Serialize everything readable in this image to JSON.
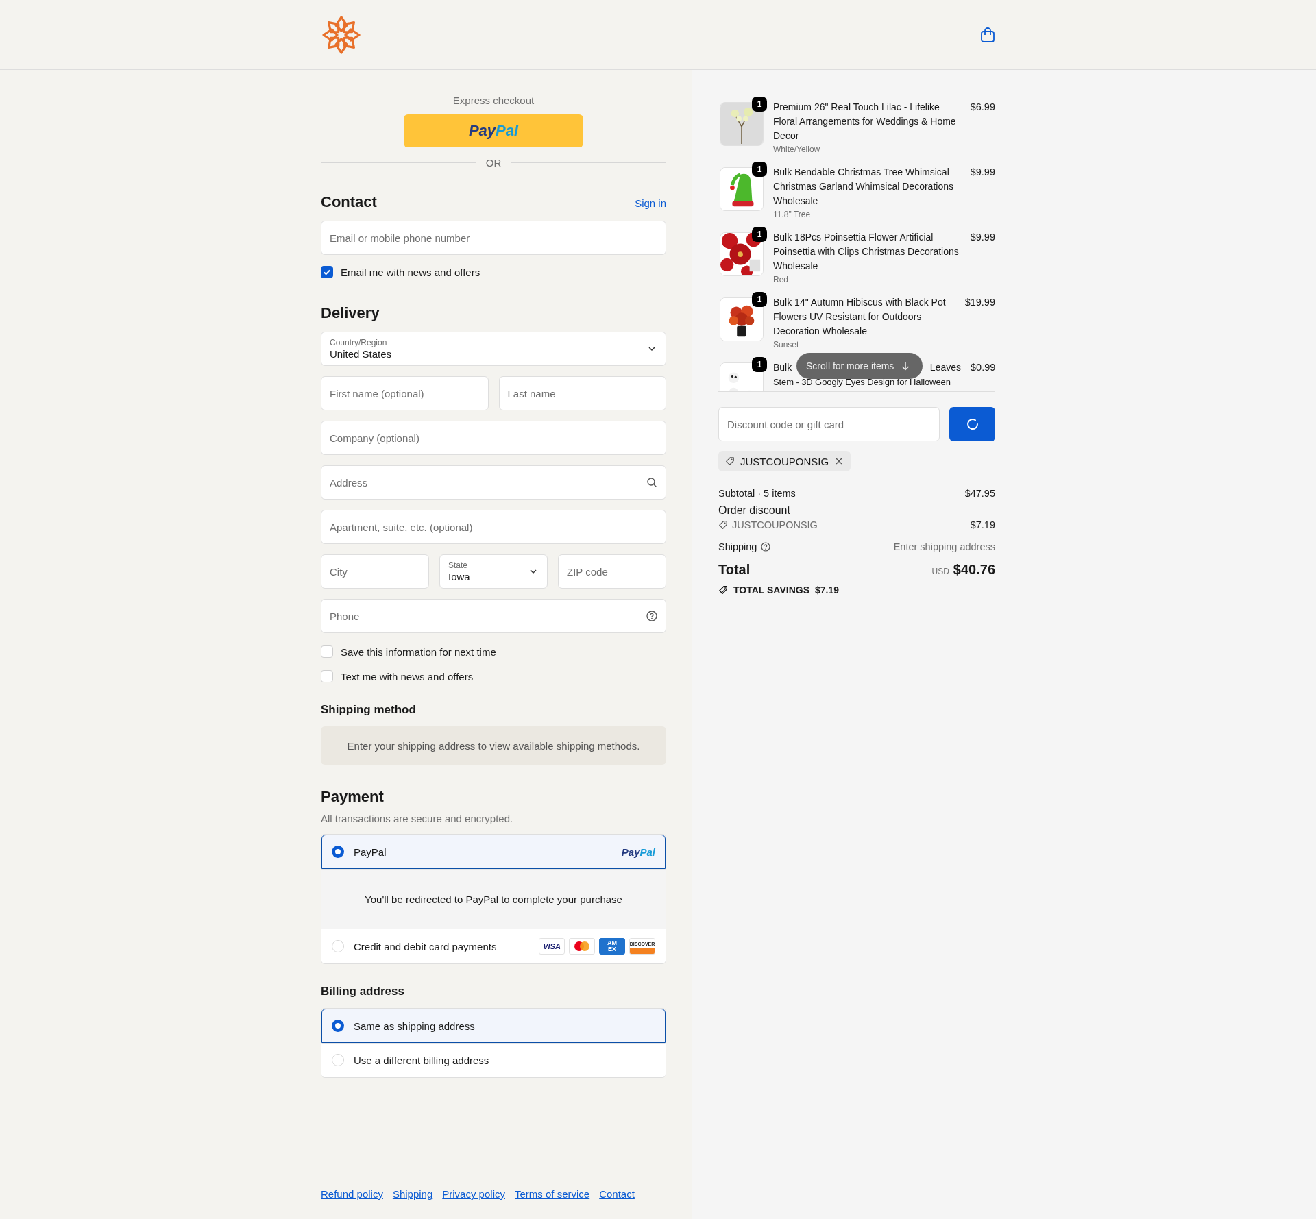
{
  "express": {
    "title": "Express checkout",
    "logo_parts": [
      "Pay",
      "Pal"
    ],
    "divider": "OR"
  },
  "contact": {
    "heading": "Contact",
    "sign_in": "Sign in",
    "email": {
      "placeholder": "Email or mobile phone number"
    },
    "news": {
      "label": "Email me with news and offers",
      "checked": true
    }
  },
  "delivery": {
    "heading": "Delivery",
    "rows": [
      [
        {
          "kind": "select",
          "label": "Country/Region",
          "value": "United States"
        }
      ],
      [
        {
          "kind": "text",
          "placeholder": "First name (optional)"
        },
        {
          "kind": "text",
          "placeholder": "Last name"
        }
      ],
      [
        {
          "kind": "text",
          "placeholder": "Company (optional)"
        }
      ],
      [
        {
          "kind": "search",
          "placeholder": "Address"
        }
      ],
      [
        {
          "kind": "text",
          "placeholder": "Apartment, suite, etc. (optional)"
        }
      ],
      [
        {
          "kind": "text",
          "placeholder": "City"
        },
        {
          "kind": "select",
          "label": "State",
          "value": "Iowa"
        },
        {
          "kind": "text",
          "placeholder": "ZIP code"
        }
      ],
      [
        {
          "kind": "help",
          "placeholder": "Phone"
        }
      ]
    ],
    "options": [
      {
        "label": "Save this information for next time",
        "checked": false
      },
      {
        "label": "Text me with news and offers",
        "checked": false
      }
    ]
  },
  "shipping_method": {
    "heading": "Shipping method",
    "notice": "Enter your shipping address to view available shipping methods."
  },
  "payment": {
    "heading": "Payment",
    "subtitle": "All transactions are secure and encrypted.",
    "methods": [
      {
        "kind": "paypal",
        "label": "PayPal",
        "selected": true,
        "logo_parts": [
          "Pay",
          "Pal"
        ],
        "detail": "You'll be redirected to PayPal to complete your purchase"
      },
      {
        "kind": "cards",
        "label": "Credit and debit card payments",
        "selected": false,
        "brands": [
          {
            "kind": "visa",
            "label": "VISA"
          },
          {
            "kind": "mastercard"
          },
          {
            "kind": "amex",
            "label": "AMEX"
          },
          {
            "kind": "discover",
            "label": "DISCOVER"
          }
        ]
      }
    ]
  },
  "billing": {
    "heading": "Billing address",
    "options": [
      {
        "label": "Same as shipping address",
        "selected": true
      },
      {
        "label": "Use a different billing address",
        "selected": false
      }
    ]
  },
  "footer_links": [
    "Refund policy",
    "Shipping",
    "Privacy policy",
    "Terms of service",
    "Contact"
  ],
  "summary": {
    "items": [
      {
        "kind": "full",
        "quantity": "1",
        "title": "Premium 26\" Real Touch Lilac - Lifelike Floral Arrangements for Weddings & Home Decor",
        "variant": "White/Yellow",
        "price": "$6.99"
      },
      {
        "kind": "full",
        "quantity": "1",
        "title": "Bulk Bendable Christmas Tree Whimsical Christmas Garland Whimsical Decorations Wholesale",
        "variant": "11.8\" Tree",
        "price": "$9.99"
      },
      {
        "kind": "full",
        "quantity": "1",
        "title": "Bulk 18Pcs Poinsettia Flower Artificial Poinsettia with Clips Christmas Decorations Wholesale",
        "variant": "Red",
        "price": "$9.99"
      },
      {
        "kind": "full",
        "quantity": "1",
        "title": "Bulk 14\" Autumn Hibiscus with Black Pot Flowers UV Resistant for Outdoors Decoration Wholesale",
        "variant": "Sunset",
        "price": "$19.99"
      },
      {
        "kind": "partial",
        "quantity": "1",
        "title_parts": [
          "Bulk",
          "Leaves"
        ],
        "title_line_2": "Stem - 3D Googly Eyes Design for Halloween",
        "price": "$0.99"
      }
    ],
    "scroll_hint": "Scroll for more items",
    "discount": {
      "placeholder": "Discount code or gift card"
    },
    "applied_code": "JUSTCOUPONSIG",
    "totals": {
      "subtotal": {
        "label": "Subtotal · 5 items",
        "value": "$47.95"
      },
      "discount": {
        "label": "Order discount",
        "code": "JUSTCOUPONSIG",
        "value": "– $7.19"
      },
      "shipping": {
        "label": "Shipping",
        "value": "Enter shipping address"
      },
      "total": {
        "label": "Total",
        "currency": "USD",
        "value": "$40.76"
      },
      "savings": {
        "label": "TOTAL SAVINGS",
        "value": "$7.19"
      }
    }
  }
}
